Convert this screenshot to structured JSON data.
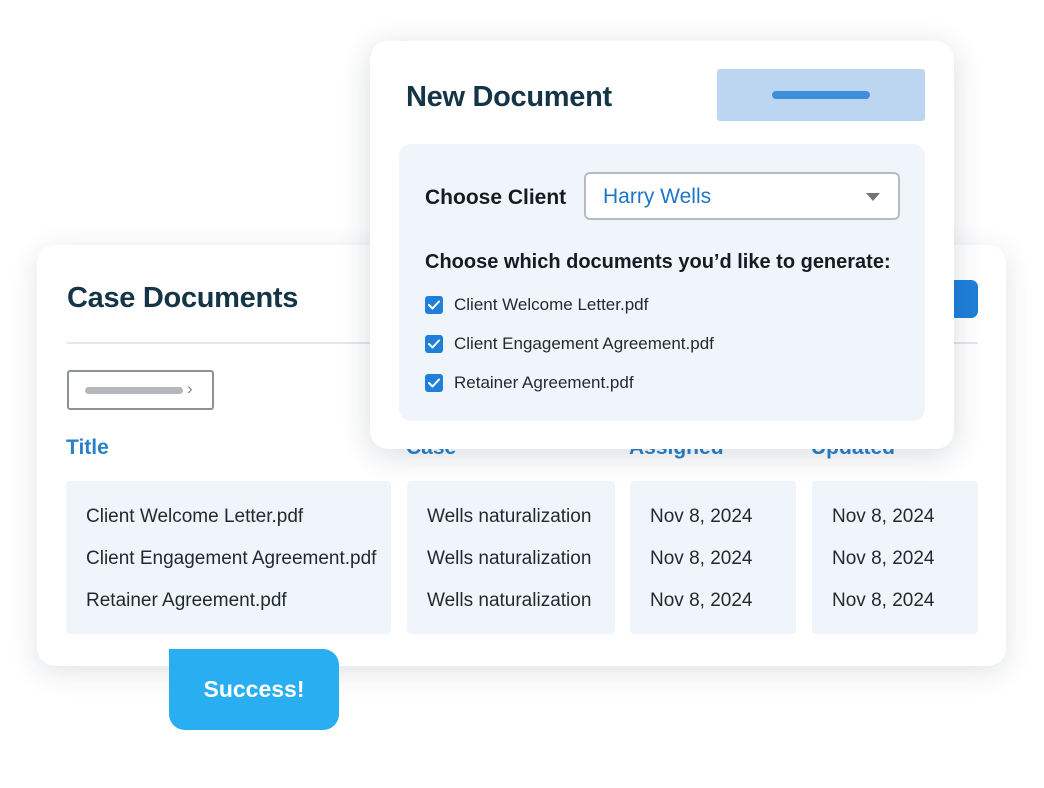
{
  "case_documents": {
    "title": "Case Documents",
    "columns": {
      "title": "Title",
      "case": "Case",
      "assigned": "Assigned",
      "updated": "Updated"
    },
    "rows": [
      {
        "title": "Client Welcome Letter.pdf",
        "case": "Wells naturalization",
        "assigned": "Nov 8, 2024",
        "updated": "Nov 8, 2024"
      },
      {
        "title": "Client Engagement Agreement.pdf",
        "case": "Wells naturalization",
        "assigned": "Nov 8, 2024",
        "updated": "Nov 8, 2024"
      },
      {
        "title": "Retainer Agreement.pdf",
        "case": "Wells naturalization",
        "assigned": "Nov 8, 2024",
        "updated": "Nov 8, 2024"
      }
    ]
  },
  "new_document": {
    "title": "New Document",
    "choose_client_label": "Choose Client",
    "client_value": "Harry Wells",
    "generate_heading": "Choose which documents you’d like to generate:",
    "options": [
      {
        "label": "Client Welcome Letter.pdf",
        "checked": true
      },
      {
        "label": "Client Engagement Agreement.pdf",
        "checked": true
      },
      {
        "label": "Retainer Agreement.pdf",
        "checked": true
      }
    ]
  },
  "toast": {
    "label": "Success!"
  },
  "icons": {
    "breadcrumb": "chevron-right-icon",
    "select": "caret-down-icon",
    "checkbox": "check-icon"
  },
  "colors": {
    "accent": "#1f7fd9",
    "header_blue": "#2a80c9",
    "title_dark": "#143545",
    "success": "#2aaef2",
    "panel_bg": "#f0f5fb"
  }
}
